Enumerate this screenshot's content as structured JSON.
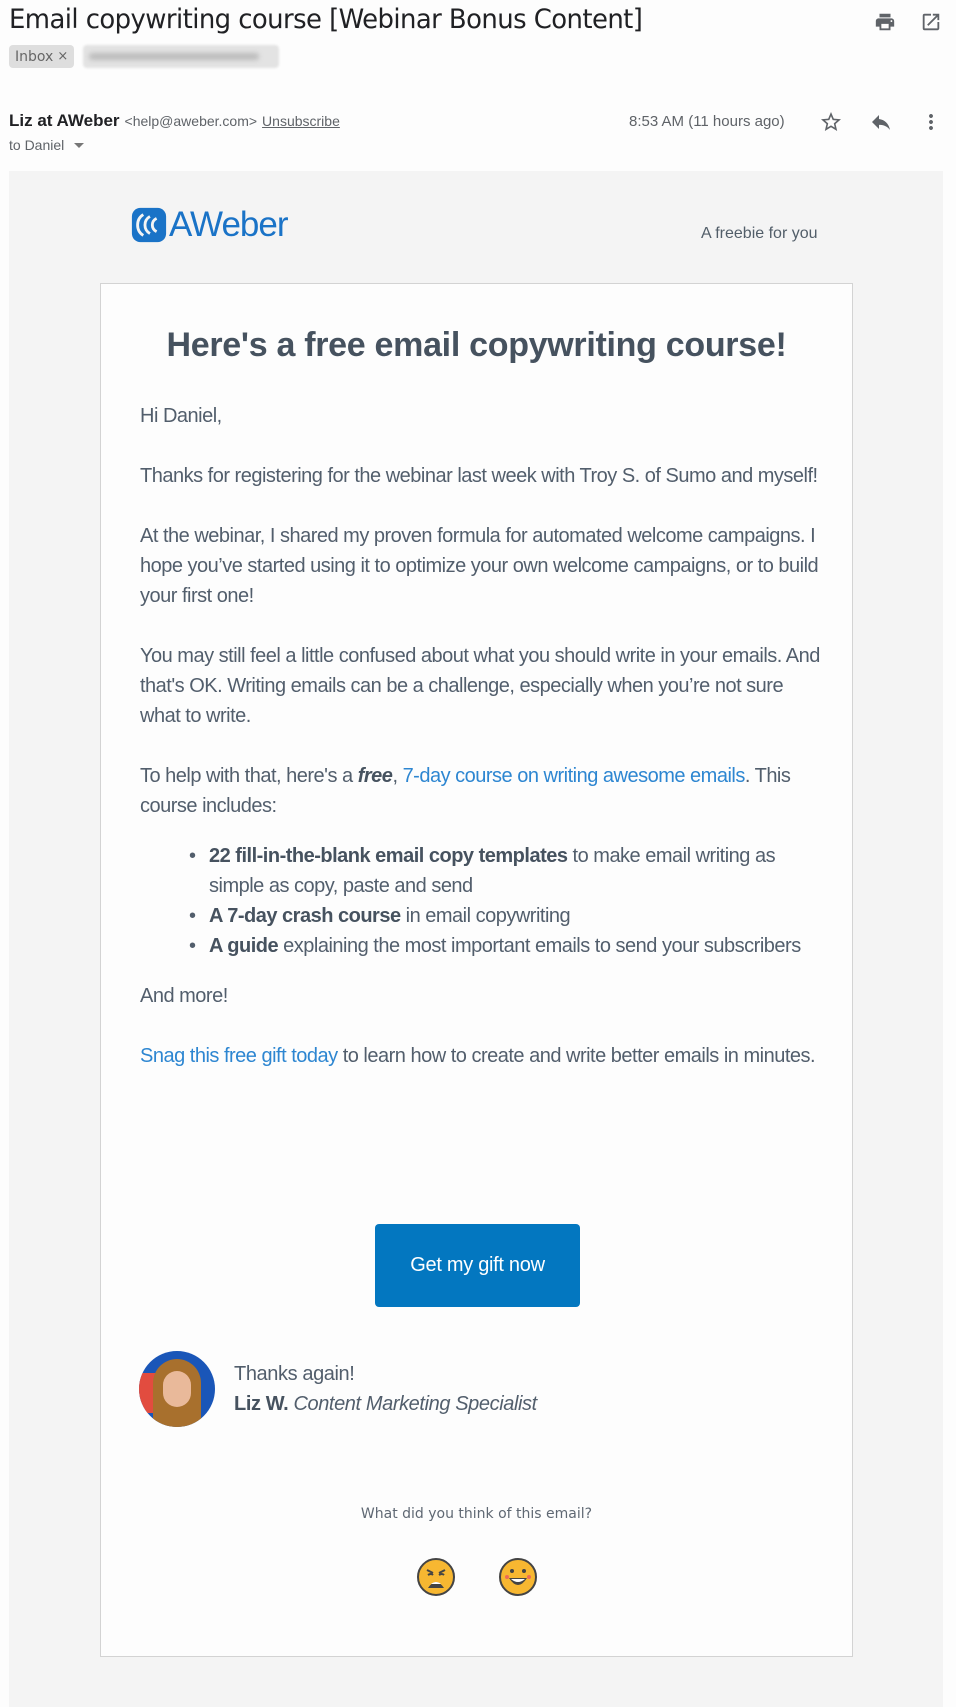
{
  "email": {
    "subject": "Email copywriting course [Webinar Bonus Content]",
    "labels": [
      {
        "text": "Inbox",
        "removable": true
      },
      {
        "text": "",
        "redacted": true
      }
    ],
    "sender": {
      "name": "Liz at AWeber",
      "address": "<help@aweber.com>",
      "unsubscribe": "Unsubscribe"
    },
    "recipient": "to Daniel",
    "timestamp": "8:53 AM (11 hours ago)",
    "icons": {
      "print": "print-icon",
      "new_window": "open-in-new-window-icon",
      "star": "star-icon",
      "reply": "reply-icon",
      "more": "more-vertical-icon"
    }
  },
  "body": {
    "brand": {
      "name": "AWeber",
      "color": "#1a73c7",
      "tagline": "A freebie for you"
    },
    "headline": "Here's a free email copywriting course!",
    "greeting": "Hi Daniel,",
    "paragraphs": [
      "Thanks for registering for the webinar last week with Troy S. of Sumo and myself!",
      "At the webinar, I shared my proven formula for automated welcome campaigns. I hope you’ve started using it to optimize your own welcome campaigns, or to build your first one!",
      "You may still feel a little confused about what you should write in your emails. And that's OK. Writing emails can be a challenge, especially when you’re not sure what to write."
    ],
    "offer": {
      "prefix": "To help with that, here's a ",
      "emphasis": "free",
      "comma": ", ",
      "link": "7-day course on writing awesome emails",
      "suffix": ". This course includes:"
    },
    "bullets": [
      {
        "bold": "22 fill-in-the-blank email copy templates",
        "rest": " to make email writing as simple as copy, paste and send"
      },
      {
        "bold": "A 7-day crash course",
        "rest": " in email copywriting"
      },
      {
        "bold": "A guide",
        "rest": " explaining the most important emails to send your subscribers"
      }
    ],
    "and_more": "And more!",
    "closing": {
      "link": "Snag this free gift today",
      "rest": " to learn how to create and write better emails in minutes."
    },
    "cta": {
      "label": "Get my gift now",
      "color": "#0377c0"
    },
    "signature": {
      "thanks": "Thanks again!",
      "name": "Liz W.",
      "role": "Content Marketing Specialist"
    },
    "feedback": {
      "question": "What did you think of this email?",
      "options": [
        "dislike",
        "like"
      ]
    }
  }
}
